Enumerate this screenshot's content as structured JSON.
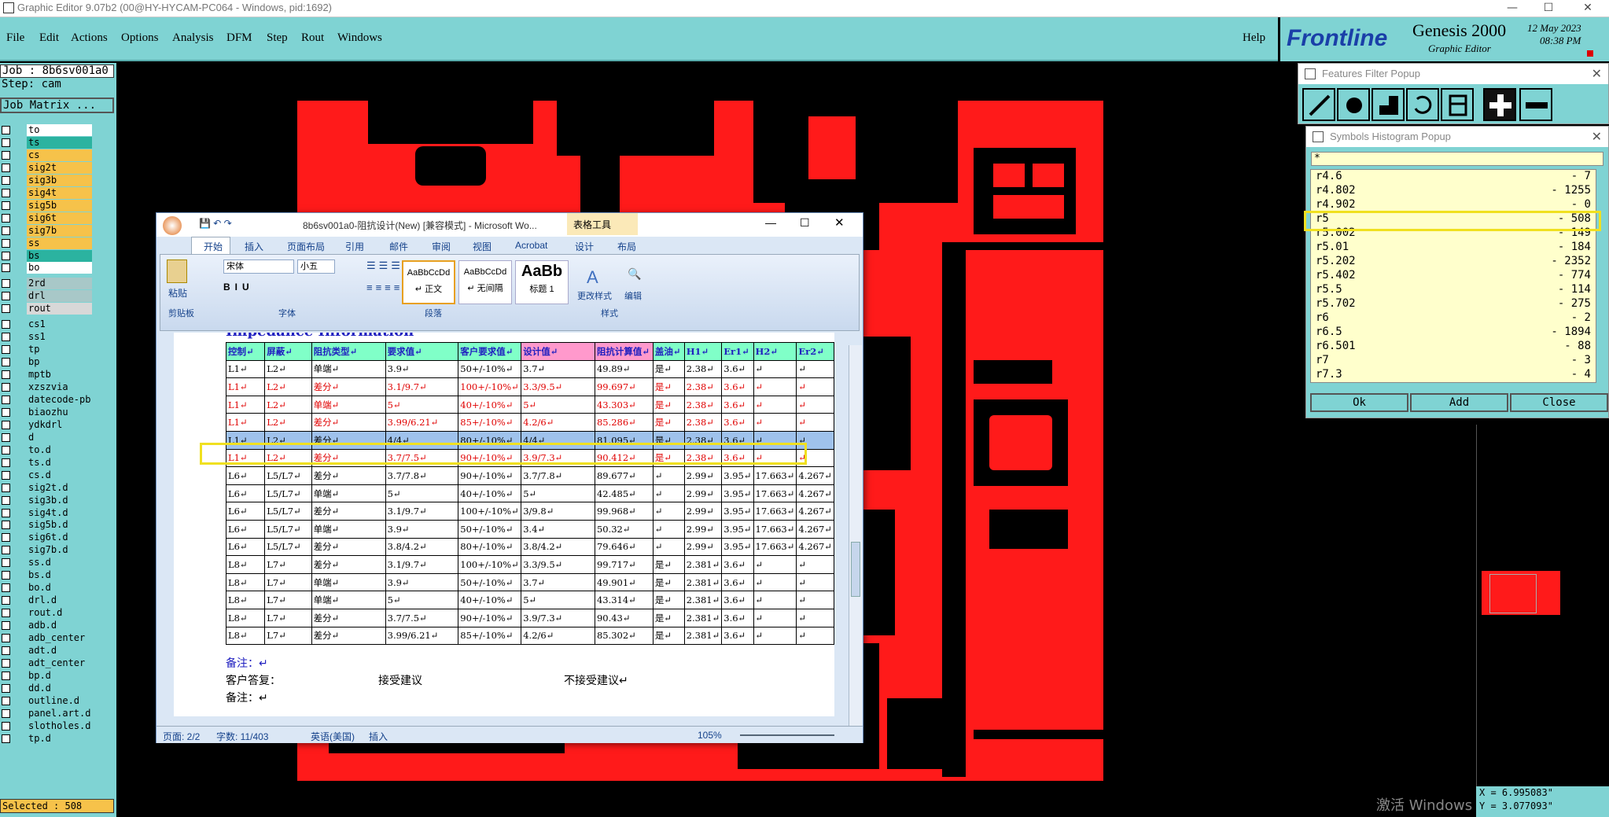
{
  "window": {
    "title": "Graphic Editor 9.07b2 (00@HY-HYCAM-PC064 - Windows, pid:1692)",
    "minimize": "—",
    "maximize": "☐",
    "close": "✕"
  },
  "menu": [
    "File",
    "Edit",
    "Actions",
    "Options",
    "Analysis",
    "DFM",
    "Step",
    "Rout",
    "Windows"
  ],
  "help": "Help",
  "brand": {
    "logo": "Frontline",
    "product": "Genesis 2000",
    "subtitle": "Graphic Editor",
    "date": "12 May 2023",
    "time": "08:38 PM"
  },
  "job": {
    "job_line": "Job : 8b6sv001a0",
    "step_line": "Step: cam",
    "matrix_button": "Job Matrix ..."
  },
  "layers": [
    {
      "name": "to",
      "color": "#ffffff"
    },
    {
      "name": "ts",
      "color": "#2bb3a0"
    },
    {
      "name": "cs",
      "color": "#f6c24a"
    },
    {
      "name": "sig2t",
      "color": "#f6c24a"
    },
    {
      "name": "sig3b",
      "color": "#f6c24a"
    },
    {
      "name": "sig4t",
      "color": "#f6c24a"
    },
    {
      "name": "sig5b",
      "color": "#f6c24a"
    },
    {
      "name": "sig6t",
      "color": "#f6c24a"
    },
    {
      "name": "sig7b",
      "color": "#f6c24a"
    },
    {
      "name": "ss",
      "color": "#f6c24a"
    },
    {
      "name": "bs",
      "color": "#2bb3a0"
    },
    {
      "name": "bo",
      "color": "#ffffff"
    },
    {
      "name": "2rd",
      "color": "#a8c8c8"
    },
    {
      "name": "drl",
      "color": "#a8c8c8"
    },
    {
      "name": "rout",
      "color": "#d8d8d8"
    },
    {
      "name": "cs1",
      "color": "#7fd3d3"
    },
    {
      "name": "ss1",
      "color": "#7fd3d3"
    },
    {
      "name": "tp",
      "color": "#7fd3d3"
    },
    {
      "name": "bp",
      "color": "#7fd3d3"
    },
    {
      "name": "mptb",
      "color": "#7fd3d3"
    },
    {
      "name": "xzszvia",
      "color": "#7fd3d3"
    },
    {
      "name": "datecode-pb",
      "color": "#7fd3d3"
    },
    {
      "name": "biaozhu",
      "color": "#7fd3d3"
    },
    {
      "name": "ydkdrl",
      "color": "#7fd3d3"
    },
    {
      "name": "d",
      "color": "#7fd3d3"
    },
    {
      "name": "to.d",
      "color": "#7fd3d3"
    },
    {
      "name": "ts.d",
      "color": "#7fd3d3"
    },
    {
      "name": "cs.d",
      "color": "#7fd3d3"
    },
    {
      "name": "sig2t.d",
      "color": "#7fd3d3"
    },
    {
      "name": "sig3b.d",
      "color": "#7fd3d3"
    },
    {
      "name": "sig4t.d",
      "color": "#7fd3d3"
    },
    {
      "name": "sig5b.d",
      "color": "#7fd3d3"
    },
    {
      "name": "sig6t.d",
      "color": "#7fd3d3"
    },
    {
      "name": "sig7b.d",
      "color": "#7fd3d3"
    },
    {
      "name": "ss.d",
      "color": "#7fd3d3"
    },
    {
      "name": "bs.d",
      "color": "#7fd3d3"
    },
    {
      "name": "bo.d",
      "color": "#7fd3d3"
    },
    {
      "name": "drl.d",
      "color": "#7fd3d3"
    },
    {
      "name": "rout.d",
      "color": "#7fd3d3"
    },
    {
      "name": "adb.d",
      "color": "#7fd3d3"
    },
    {
      "name": "adb_center",
      "color": "#7fd3d3"
    },
    {
      "name": "adt.d",
      "color": "#7fd3d3"
    },
    {
      "name": "adt_center",
      "color": "#7fd3d3"
    },
    {
      "name": "bp.d",
      "color": "#7fd3d3"
    },
    {
      "name": "dd.d",
      "color": "#7fd3d3"
    },
    {
      "name": "outline.d",
      "color": "#7fd3d3"
    },
    {
      "name": "panel.art.d",
      "color": "#7fd3d3"
    },
    {
      "name": "slotholes.d",
      "color": "#7fd3d3"
    },
    {
      "name": "tp.d",
      "color": "#7fd3d3"
    }
  ],
  "selected": "Selected : 508",
  "features_filter": {
    "title": "Features Filter Popup"
  },
  "histogram": {
    "title": "Symbols Histogram Popup",
    "filter": "*",
    "rows": [
      {
        "name": "r4.6",
        "count": "- 7"
      },
      {
        "name": "r4.802",
        "count": "- 1255"
      },
      {
        "name": "r4.902",
        "count": "- 0"
      },
      {
        "name": "r5",
        "count": "- 508"
      },
      {
        "name": "r5.002",
        "count": "- 149"
      },
      {
        "name": "r5.01",
        "count": "- 184"
      },
      {
        "name": "r5.202",
        "count": "- 2352"
      },
      {
        "name": "r5.402",
        "count": "- 774"
      },
      {
        "name": "r5.5",
        "count": "- 114"
      },
      {
        "name": "r5.702",
        "count": "- 275"
      },
      {
        "name": "r6",
        "count": "- 2"
      },
      {
        "name": "r6.5",
        "count": "- 1894"
      },
      {
        "name": "r6.501",
        "count": "- 88"
      },
      {
        "name": "r7",
        "count": "- 3"
      },
      {
        "name": "r7.3",
        "count": "- 4"
      }
    ],
    "buttons": {
      "ok": "Ok",
      "add": "Add",
      "close": "Close"
    }
  },
  "coords": {
    "x": "X = 6.995083\"",
    "y": "Y = 3.077093\""
  },
  "word": {
    "title": "8b6sv001a0-阻抗设计(New) [兼容模式] - Microsoft Wo...",
    "table_tools": "表格工具",
    "tabs": [
      "开始",
      "插入",
      "页面布局",
      "引用",
      "邮件",
      "审阅",
      "视图",
      "Acrobat",
      "设计",
      "布局"
    ],
    "font_name": "宋体",
    "font_size": "小五",
    "paste": "粘贴",
    "groups": [
      "剪贴板",
      "字体",
      "段落",
      "样式",
      "编辑"
    ],
    "styles": [
      {
        "sample": "AaBbCcDd",
        "name": "↵ 正文"
      },
      {
        "sample": "AaBbCcDd",
        "name": "↵ 无间隔"
      },
      {
        "sample": "AaBb",
        "name": "标题 1"
      }
    ],
    "change_styles": "更改样式",
    "edit": "编辑",
    "heading_fragment": "Impedance Information",
    "table_header": [
      "控制↵",
      "屏蔽↵",
      "阻抗类型↵",
      "要求值↵",
      "客户要求值↵",
      "设计值↵",
      "阻抗计算值↵",
      "盖油↵",
      "H1↵",
      "Er1↵",
      "H2↵",
      "Er2↵"
    ],
    "table_rows": [
      {
        "style": "",
        "cells": [
          "L1↵",
          "L2↵",
          "单端↵",
          "3.9↵",
          "50+/-10%↵",
          "3.7↵",
          "49.89↵",
          "是↵",
          "2.38↵",
          "3.6↵",
          "↵",
          "↵"
        ]
      },
      {
        "style": "red",
        "cells": [
          "L1↵",
          "L2↵",
          "差分↵",
          "3.1/9.7↵",
          "100+/-10%↵",
          "3.3/9.5↵",
          "99.697↵",
          "是↵",
          "2.38↵",
          "3.6↵",
          "↵",
          "↵"
        ]
      },
      {
        "style": "red",
        "cells": [
          "L1↵",
          "L2↵",
          "单端↵",
          "5↵",
          "40+/-10%↵",
          "5↵",
          "43.303↵",
          "是↵",
          "2.38↵",
          "3.6↵",
          "↵",
          "↵"
        ]
      },
      {
        "style": "red",
        "cells": [
          "L1↵",
          "L2↵",
          "差分↵",
          "3.99/6.21↵",
          "85+/-10%↵",
          "4.2/6↵",
          "85.286↵",
          "是↵",
          "2.38↵",
          "3.6↵",
          "↵",
          "↵"
        ]
      },
      {
        "style": "sel",
        "cells": [
          "L1↵",
          "L2↵",
          "差分↵",
          "4/4↵",
          "80+/-10%↵",
          "4/4↵",
          "81.095↵",
          "是↵",
          "2.38↵",
          "3.6↵",
          "↵",
          "↵"
        ]
      },
      {
        "style": "red",
        "cells": [
          "L1↵",
          "L2↵",
          "差分↵",
          "3.7/7.5↵",
          "90+/-10%↵",
          "3.9/7.3↵",
          "90.412↵",
          "是↵",
          "2.38↵",
          "3.6↵",
          "↵",
          "↵"
        ]
      },
      {
        "style": "",
        "cells": [
          "L6↵",
          "L5/L7↵",
          "差分↵",
          "3.7/7.8↵",
          "90+/-10%↵",
          "3.7/7.8↵",
          "89.677↵",
          "↵",
          "2.99↵",
          "3.95↵",
          "17.663↵",
          "4.267↵"
        ]
      },
      {
        "style": "",
        "cells": [
          "L6↵",
          "L5/L7↵",
          "单端↵",
          "5↵",
          "40+/-10%↵",
          "5↵",
          "42.485↵",
          "↵",
          "2.99↵",
          "3.95↵",
          "17.663↵",
          "4.267↵"
        ]
      },
      {
        "style": "",
        "cells": [
          "L6↵",
          "L5/L7↵",
          "差分↵",
          "3.1/9.7↵",
          "100+/-10%↵",
          "3/9.8↵",
          "99.968↵",
          "↵",
          "2.99↵",
          "3.95↵",
          "17.663↵",
          "4.267↵"
        ]
      },
      {
        "style": "",
        "cells": [
          "L6↵",
          "L5/L7↵",
          "单端↵",
          "3.9↵",
          "50+/-10%↵",
          "3.4↵",
          "50.32↵",
          "↵",
          "2.99↵",
          "3.95↵",
          "17.663↵",
          "4.267↵"
        ]
      },
      {
        "style": "",
        "cells": [
          "L6↵",
          "L5/L7↵",
          "差分↵",
          "3.8/4.2↵",
          "80+/-10%↵",
          "3.8/4.2↵",
          "79.646↵",
          "↵",
          "2.99↵",
          "3.95↵",
          "17.663↵",
          "4.267↵"
        ]
      },
      {
        "style": "",
        "cells": [
          "L8↵",
          "L7↵",
          "差分↵",
          "3.1/9.7↵",
          "100+/-10%↵",
          "3.3/9.5↵",
          "99.717↵",
          "是↵",
          "2.381↵",
          "3.6↵",
          "↵",
          "↵"
        ]
      },
      {
        "style": "",
        "cells": [
          "L8↵",
          "L7↵",
          "单端↵",
          "3.9↵",
          "50+/-10%↵",
          "3.7↵",
          "49.901↵",
          "是↵",
          "2.381↵",
          "3.6↵",
          "↵",
          "↵"
        ]
      },
      {
        "style": "",
        "cells": [
          "L8↵",
          "L7↵",
          "单端↵",
          "5↵",
          "40+/-10%↵",
          "5↵",
          "43.314↵",
          "是↵",
          "2.381↵",
          "3.6↵",
          "↵",
          "↵"
        ]
      },
      {
        "style": "",
        "cells": [
          "L8↵",
          "L7↵",
          "差分↵",
          "3.7/7.5↵",
          "90+/-10%↵",
          "3.9/7.3↵",
          "90.43↵",
          "是↵",
          "2.381↵",
          "3.6↵",
          "↵",
          "↵"
        ]
      },
      {
        "style": "",
        "cells": [
          "L8↵",
          "L7↵",
          "差分↵",
          "3.99/6.21↵",
          "85+/-10%↵",
          "4.2/6↵",
          "85.302↵",
          "是↵",
          "2.381↵",
          "3.6↵",
          "↵",
          "↵"
        ]
      }
    ],
    "note1": "备注：↵",
    "reply": "客户答复：",
    "accept": "接受建议",
    "reject": "不接受建议↵",
    "note2": "备注：↵",
    "status": {
      "page": "页面: 2/2",
      "words": "字数: 11/403",
      "language": "英语(美国)",
      "mode": "插入",
      "zoom": "105%"
    }
  },
  "watermark": "激活 Windows"
}
